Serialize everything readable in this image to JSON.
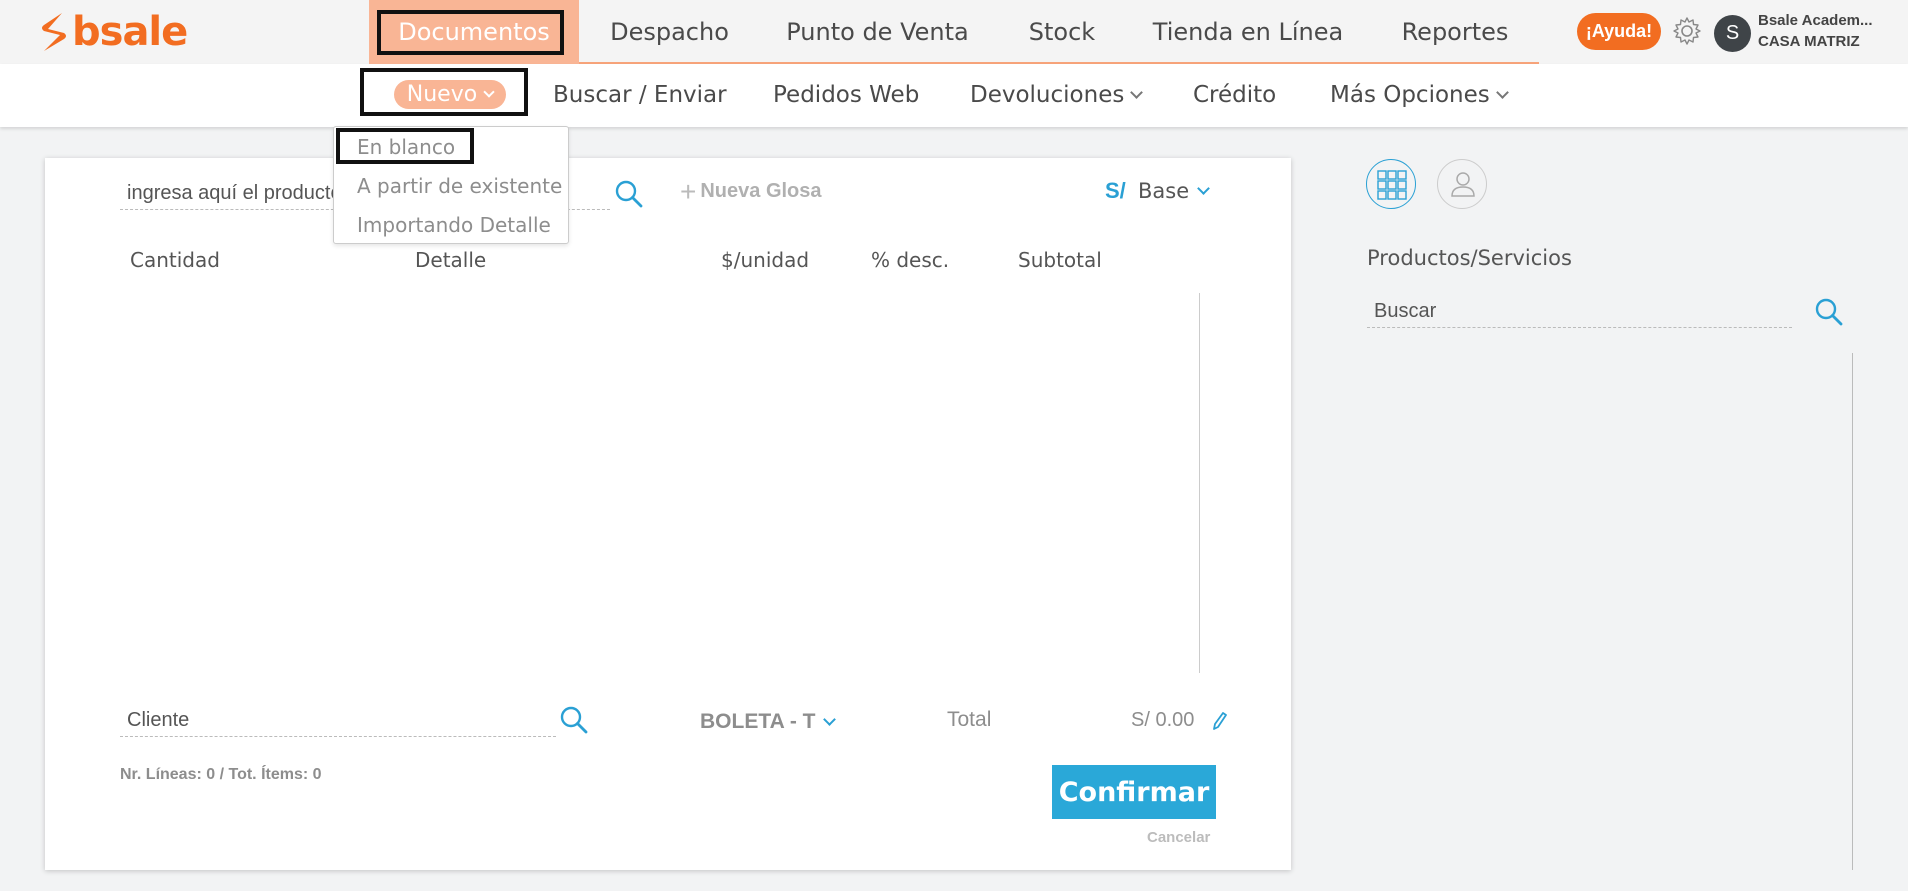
{
  "brand": {
    "name": "bsale",
    "color": "#f26d21",
    "icon": "bsale-s-logo-icon"
  },
  "main_nav": {
    "tabs": [
      {
        "label": "Documentos",
        "active": true
      },
      {
        "label": "Despacho"
      },
      {
        "label": "Punto de Venta"
      },
      {
        "label": "Stock"
      },
      {
        "label": "Tienda en Línea"
      },
      {
        "label": "Reportes"
      }
    ]
  },
  "header": {
    "help_label": "¡Ayuda!",
    "settings_icon": "gear-icon",
    "avatar_initial": "S",
    "user_name": "Bsale Academ...",
    "branch": "CASA MATRIZ"
  },
  "sub_nav": {
    "items": [
      {
        "label": "Nuevo",
        "active": true,
        "has_dropdown": true
      },
      {
        "label": "Buscar / Enviar"
      },
      {
        "label": "Pedidos Web"
      },
      {
        "label": "Devoluciones",
        "has_dropdown": true
      },
      {
        "label": "Crédito"
      },
      {
        "label": "Más Opciones",
        "has_dropdown": true
      }
    ]
  },
  "nuevo_menu": {
    "items": [
      {
        "label": "En blanco",
        "highlighted": true
      },
      {
        "label": "A partir de existente"
      },
      {
        "label": "Importando Detalle"
      }
    ]
  },
  "document": {
    "product_placeholder": "ingresa aquí el producto",
    "nueva_glosa": "Nueva Glosa",
    "currency_symbol": "S/",
    "price_list": "Base",
    "columns": [
      "Cantidad",
      "Detalle",
      "$/unidad",
      "% desc.",
      "Subtotal"
    ],
    "client_placeholder": "Cliente",
    "document_type": "BOLETA - T",
    "total_label": "Total",
    "total_value": "S/ 0.00",
    "lines_info": "Nr. Líneas: 0 / Tot. Ítems: 0",
    "confirm_label": "Confirmar",
    "cancel_label": "Cancelar"
  },
  "products_panel": {
    "title": "Productos/Servicios",
    "search_placeholder": "Buscar",
    "view_icons": [
      "grid-view-icon",
      "client-view-icon"
    ]
  },
  "colors": {
    "accent_orange": "#f26d21",
    "active_tab": "#f9b595",
    "accent_blue": "#2aa8d8"
  }
}
